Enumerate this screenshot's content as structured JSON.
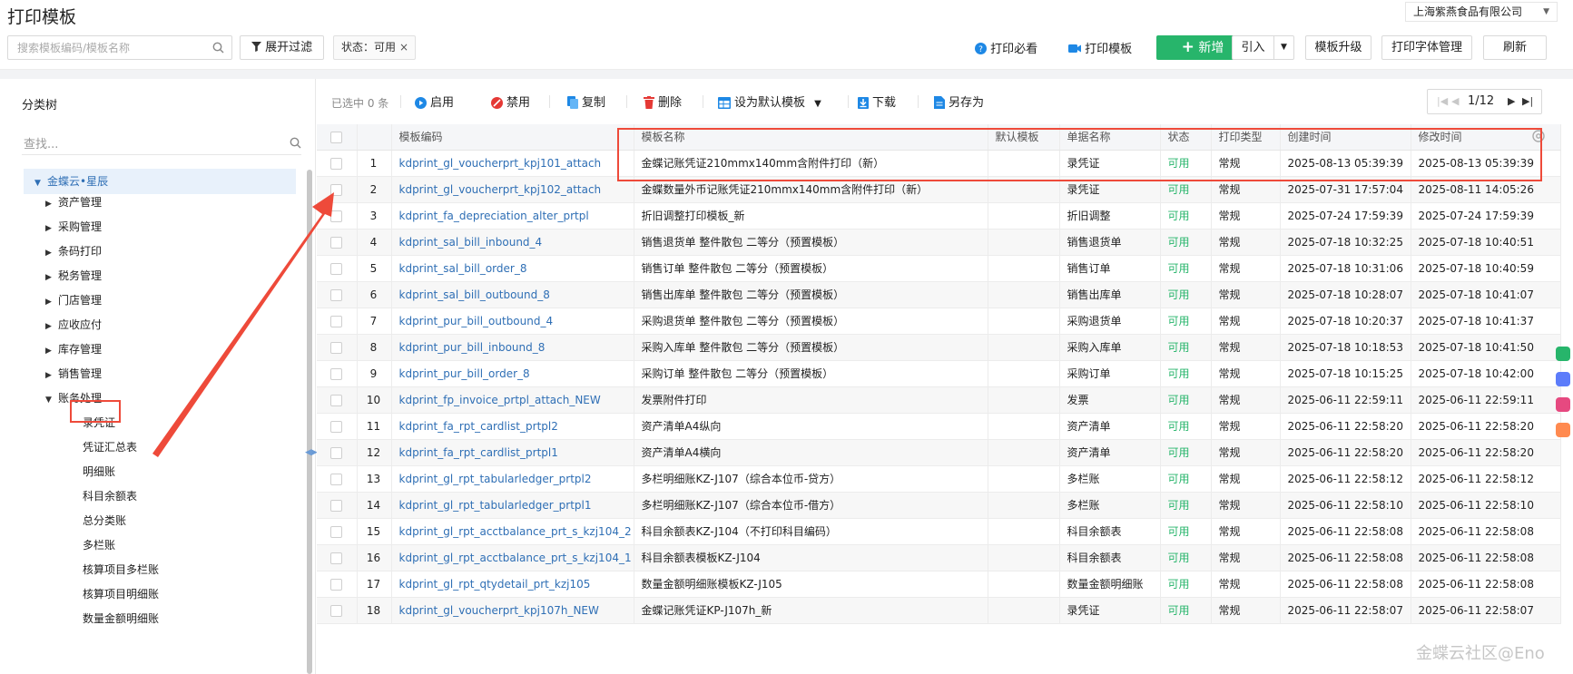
{
  "header": {
    "title": "打印模板",
    "company": "上海紫燕食品有限公司",
    "search_placeholder": "搜索模板编码/模板名称",
    "filter_label": "展开过滤",
    "status_tag": "状态：可用",
    "help_label": "打印必看",
    "template_label": "打印模板",
    "new_label": "新增",
    "import_label": "引入",
    "upgrade_label": "模板升级",
    "font_label": "打印字体管理",
    "refresh_label": "刷新"
  },
  "sidebar": {
    "title": "分类树",
    "search_placeholder": "查找...",
    "root": "金蝶云•星辰",
    "groups": [
      "资产管理",
      "采购管理",
      "条码打印",
      "税务管理",
      "门店管理",
      "应收应付",
      "库存管理",
      "销售管理",
      "账务处理"
    ],
    "children": [
      "录凭证",
      "凭证汇总表",
      "明细账",
      "科目余额表",
      "总分类账",
      "多栏账",
      "核算项目多栏账",
      "核算项目明细账",
      "数量金额明细账"
    ]
  },
  "toolbar": {
    "selected": "已选中 0 条",
    "enable": "启用",
    "disable": "禁用",
    "copy": "复制",
    "delete": "删除",
    "set_default": "设为默认模板",
    "download": "下载",
    "save_as": "另存为",
    "page": "1/12"
  },
  "table": {
    "columns": [
      "模板编码",
      "模板名称",
      "默认模板",
      "单据名称",
      "状态",
      "打印类型",
      "创建时间",
      "修改时间"
    ],
    "rows": [
      {
        "seq": "1",
        "code": "kdprint_gl_voucherprt_kpj101_attach",
        "name": "金蝶记账凭证210mmx140mm含附件打印（新）",
        "default": "",
        "bill": "录凭证",
        "status": "可用",
        "type": "常规",
        "created": "2025-08-13 05:39:39",
        "modified": "2025-08-13 05:39:39"
      },
      {
        "seq": "2",
        "code": "kdprint_gl_voucherprt_kpj102_attach",
        "name": "金蝶数量外币记账凭证210mmx140mm含附件打印（新）",
        "default": "",
        "bill": "录凭证",
        "status": "可用",
        "type": "常规",
        "created": "2025-07-31 17:57:04",
        "modified": "2025-08-11 14:05:26"
      },
      {
        "seq": "3",
        "code": "kdprint_fa_depreciation_alter_prtpl",
        "name": "折旧调整打印模板_新",
        "default": "",
        "bill": "折旧调整",
        "status": "可用",
        "type": "常规",
        "created": "2025-07-24 17:59:39",
        "modified": "2025-07-24 17:59:39"
      },
      {
        "seq": "4",
        "code": "kdprint_sal_bill_inbound_4",
        "name": "销售退货单 整件散包 二等分（预置模板）",
        "default": "",
        "bill": "销售退货单",
        "status": "可用",
        "type": "常规",
        "created": "2025-07-18 10:32:25",
        "modified": "2025-07-18 10:40:51"
      },
      {
        "seq": "5",
        "code": "kdprint_sal_bill_order_8",
        "name": "销售订单 整件散包 二等分（预置模板）",
        "default": "",
        "bill": "销售订单",
        "status": "可用",
        "type": "常规",
        "created": "2025-07-18 10:31:06",
        "modified": "2025-07-18 10:40:59"
      },
      {
        "seq": "6",
        "code": "kdprint_sal_bill_outbound_8",
        "name": "销售出库单 整件散包 二等分（预置模板）",
        "default": "",
        "bill": "销售出库单",
        "status": "可用",
        "type": "常规",
        "created": "2025-07-18 10:28:07",
        "modified": "2025-07-18 10:41:07"
      },
      {
        "seq": "7",
        "code": "kdprint_pur_bill_outbound_4",
        "name": "采购退货单 整件散包 二等分（预置模板）",
        "default": "",
        "bill": "采购退货单",
        "status": "可用",
        "type": "常规",
        "created": "2025-07-18 10:20:37",
        "modified": "2025-07-18 10:41:37"
      },
      {
        "seq": "8",
        "code": "kdprint_pur_bill_inbound_8",
        "name": "采购入库单 整件散包 二等分（预置模板）",
        "default": "",
        "bill": "采购入库单",
        "status": "可用",
        "type": "常规",
        "created": "2025-07-18 10:18:53",
        "modified": "2025-07-18 10:41:50"
      },
      {
        "seq": "9",
        "code": "kdprint_pur_bill_order_8",
        "name": "采购订单 整件散包 二等分（预置模板）",
        "default": "",
        "bill": "采购订单",
        "status": "可用",
        "type": "常规",
        "created": "2025-07-18 10:15:25",
        "modified": "2025-07-18 10:42:00"
      },
      {
        "seq": "10",
        "code": "kdprint_fp_invoice_prtpl_attach_NEW",
        "name": "发票附件打印",
        "default": "",
        "bill": "发票",
        "status": "可用",
        "type": "常规",
        "created": "2025-06-11 22:59:11",
        "modified": "2025-06-11 22:59:11"
      },
      {
        "seq": "11",
        "code": "kdprint_fa_rpt_cardlist_prtpl2",
        "name": "资产清单A4纵向",
        "default": "",
        "bill": "资产清单",
        "status": "可用",
        "type": "常规",
        "created": "2025-06-11 22:58:20",
        "modified": "2025-06-11 22:58:20"
      },
      {
        "seq": "12",
        "code": "kdprint_fa_rpt_cardlist_prtpl1",
        "name": "资产清单A4横向",
        "default": "",
        "bill": "资产清单",
        "status": "可用",
        "type": "常规",
        "created": "2025-06-11 22:58:20",
        "modified": "2025-06-11 22:58:20"
      },
      {
        "seq": "13",
        "code": "kdprint_gl_rpt_tabularledger_prtpl2",
        "name": "多栏明细账KZ-J107（综合本位币-贷方）",
        "default": "",
        "bill": "多栏账",
        "status": "可用",
        "type": "常规",
        "created": "2025-06-11 22:58:12",
        "modified": "2025-06-11 22:58:12"
      },
      {
        "seq": "14",
        "code": "kdprint_gl_rpt_tabularledger_prtpl1",
        "name": "多栏明细账KZ-J107（综合本位币-借方）",
        "default": "",
        "bill": "多栏账",
        "status": "可用",
        "type": "常规",
        "created": "2025-06-11 22:58:10",
        "modified": "2025-06-11 22:58:10"
      },
      {
        "seq": "15",
        "code": "kdprint_gl_rpt_acctbalance_prt_s_kzj104_2",
        "name": "科目余额表KZ-J104（不打印科目编码）",
        "default": "",
        "bill": "科目余额表",
        "status": "可用",
        "type": "常规",
        "created": "2025-06-11 22:58:08",
        "modified": "2025-06-11 22:58:08"
      },
      {
        "seq": "16",
        "code": "kdprint_gl_rpt_acctbalance_prt_s_kzj104_1",
        "name": "科目余额表模板KZ-J104",
        "default": "",
        "bill": "科目余额表",
        "status": "可用",
        "type": "常规",
        "created": "2025-06-11 22:58:08",
        "modified": "2025-06-11 22:58:08"
      },
      {
        "seq": "17",
        "code": "kdprint_gl_rpt_qtydetail_prt_kzj105",
        "name": "数量金额明细账模板KZ-J105",
        "default": "",
        "bill": "数量金额明细账",
        "status": "可用",
        "type": "常规",
        "created": "2025-06-11 22:58:08",
        "modified": "2025-06-11 22:58:08"
      },
      {
        "seq": "18",
        "code": "kdprint_gl_voucherprt_kpj107h_NEW",
        "name": "金蝶记账凭证KP-J107h_新",
        "default": "",
        "bill": "录凭证",
        "status": "可用",
        "type": "常规",
        "created": "2025-06-11 22:58:07",
        "modified": "2025-06-11 22:58:07"
      }
    ]
  },
  "watermark": "金蝶云社区@Eno",
  "colors": {
    "accent": "#2f6fb5",
    "status_ok": "#27b56b",
    "highlight": "#ee4a3a"
  }
}
